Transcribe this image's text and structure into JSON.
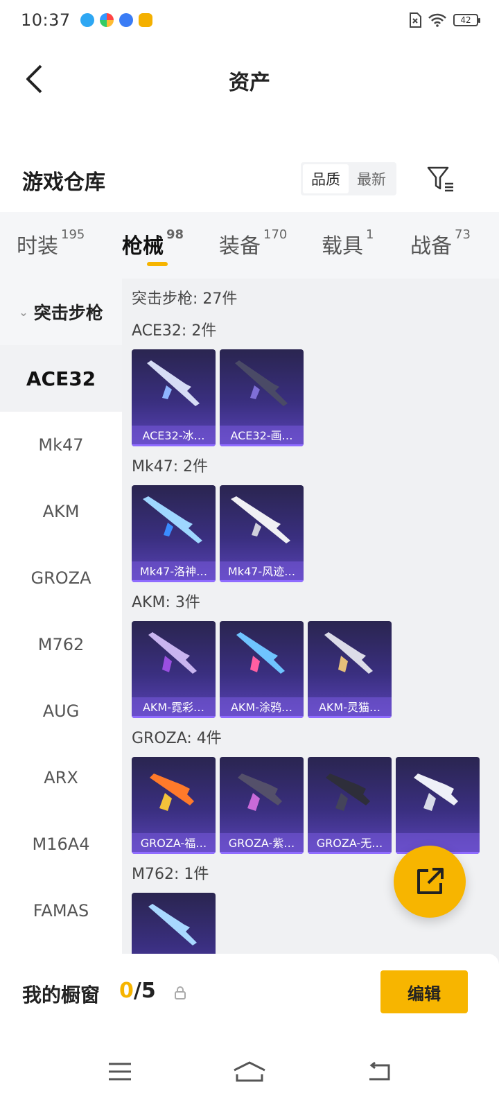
{
  "status": {
    "time": "10:37",
    "battery": "42"
  },
  "header": {
    "title": "资产"
  },
  "warehouse": {
    "title": "游戏仓库",
    "sort_options": [
      "品质",
      "最新"
    ]
  },
  "tabs": [
    {
      "label": "时装",
      "count": "195"
    },
    {
      "label": "枪械",
      "count": "98"
    },
    {
      "label": "装备",
      "count": "170"
    },
    {
      "label": "载具",
      "count": "1"
    },
    {
      "label": "战备",
      "count": "73"
    }
  ],
  "sidebar": {
    "group_label": "突击步枪",
    "items": [
      "ACE32",
      "Mk47",
      "AKM",
      "GROZA",
      "M762",
      "AUG",
      "ARX",
      "M16A4",
      "FAMAS"
    ]
  },
  "content": {
    "summary": "突击步枪: 27件",
    "sections": [
      {
        "title": "ACE32: 2件",
        "cards": [
          "ACE32-冰…",
          "ACE32-画…"
        ]
      },
      {
        "title": "Mk47: 2件",
        "cards": [
          "Mk47-洛神…",
          "Mk47-风迹…"
        ]
      },
      {
        "title": "AKM: 3件",
        "cards": [
          "AKM-霓彩…",
          "AKM-涂鸦…",
          "AKM-灵猫…"
        ]
      },
      {
        "title": "GROZA: 4件",
        "cards": [
          "GROZA-福…",
          "GROZA-紫…",
          "GROZA-无…",
          ""
        ]
      },
      {
        "title": "M762: 1件",
        "cards": [
          ""
        ]
      }
    ]
  },
  "bottom": {
    "showcase_label": "我的橱窗",
    "showcase_current": "0",
    "showcase_total": "/5",
    "edit_label": "编辑"
  },
  "colors": {
    "accent": "#f7b500",
    "card_bg": "#3a2f80"
  },
  "icons": {
    "back": "chevron-left-icon",
    "filter": "filter-icon",
    "share": "share-export-icon",
    "lock": "lock-icon",
    "nav_menu": "menu-icon",
    "nav_home": "home-icon",
    "nav_back": "back-icon"
  }
}
